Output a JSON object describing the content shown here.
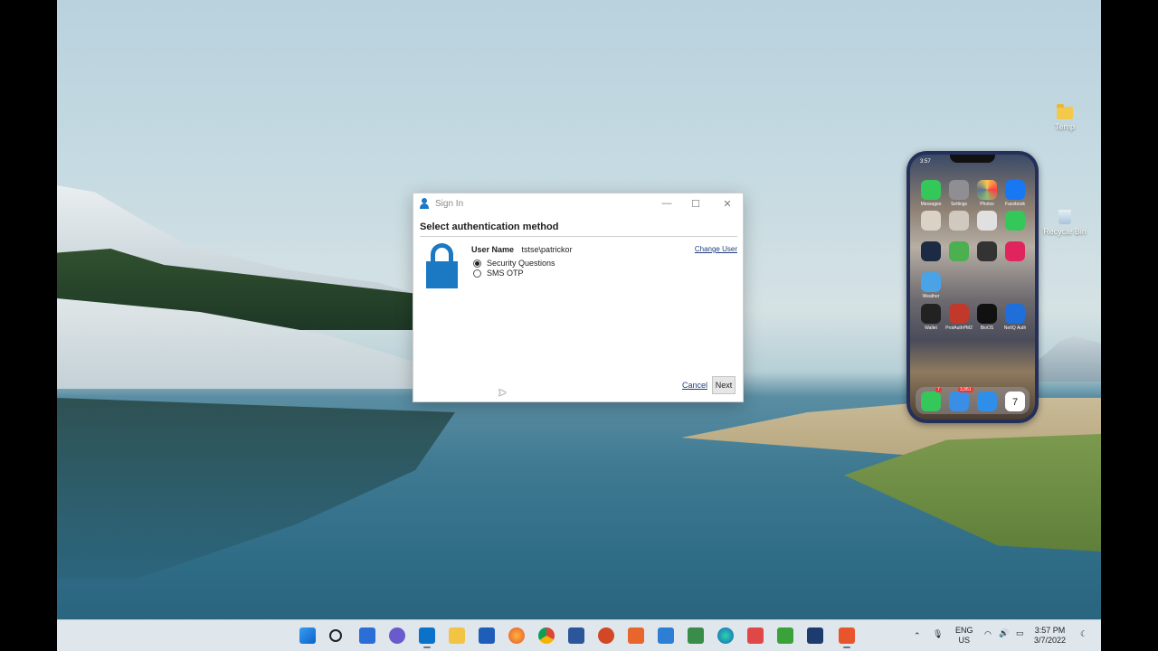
{
  "desktop": {
    "icons": [
      {
        "label": "Temp",
        "icon": "folder-icon"
      },
      {
        "label": "Recycle Bin",
        "icon": "recycle-bin-icon"
      }
    ]
  },
  "dialog": {
    "title": "Sign In",
    "heading": "Select authentication method",
    "user_name_label": "User Name",
    "user_name_value": "tstse\\patrickor",
    "change_user": "Change User",
    "options": [
      {
        "label": "Security Questions",
        "selected": true
      },
      {
        "label": "SMS OTP",
        "selected": false
      }
    ],
    "cancel_label": "Cancel",
    "next_label": "Next",
    "window_buttons": {
      "minimize": "—",
      "maximize": "☐",
      "close": "✕"
    }
  },
  "phone": {
    "time": "3:57",
    "apps_row1": [
      "Messages",
      "Settings",
      "Photos",
      "Facebook"
    ],
    "row3_label": "Weather",
    "apps_row4": [
      "Wallet",
      "ProtAuthPM2",
      "BioOS",
      "NetIQ Auth"
    ],
    "dock_badges": {
      "phone": "7",
      "mail": "3,951"
    },
    "calendar_day": "7"
  },
  "taskbar": {
    "tray": {
      "language_top": "ENG",
      "language_bottom": "US",
      "time": "3:57 PM",
      "date": "3/7/2022"
    }
  },
  "colors": {
    "accent": "#1b79c4",
    "taskbar": "#dfe6ec"
  }
}
